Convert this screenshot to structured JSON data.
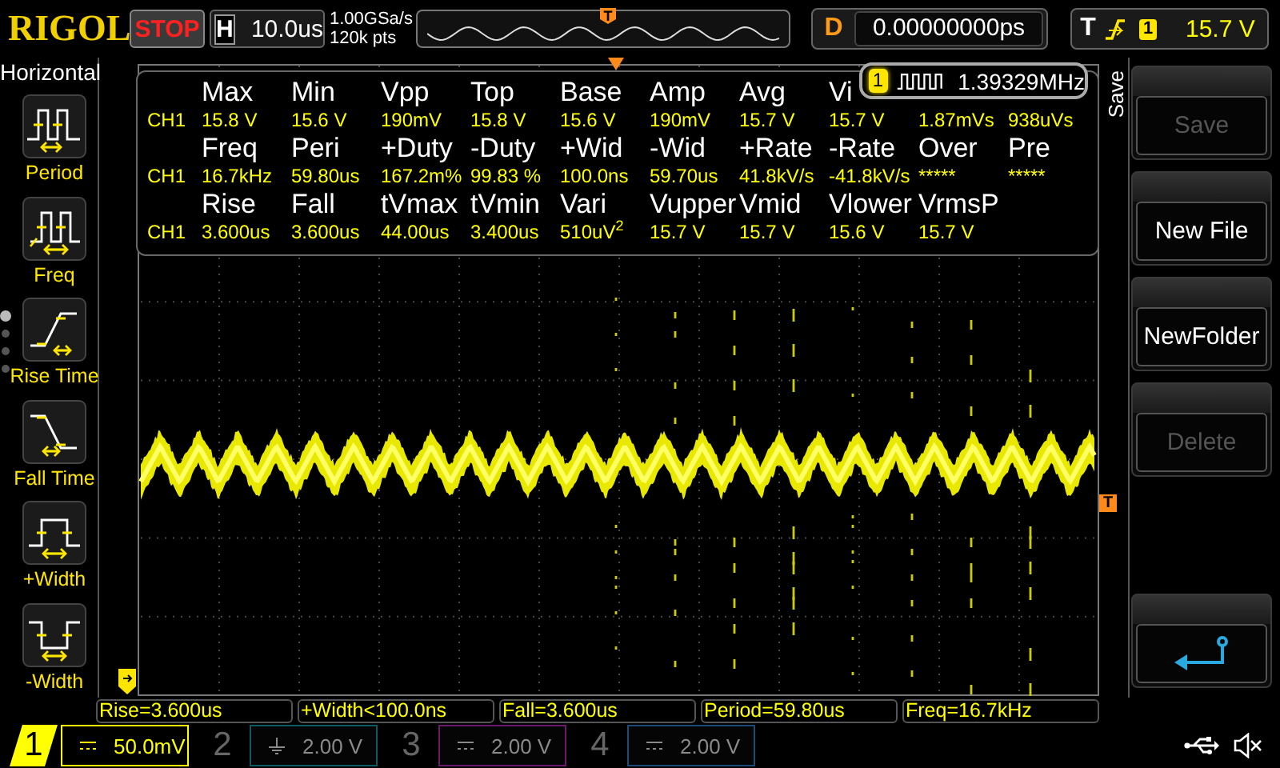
{
  "header": {
    "logo": "RIGOL",
    "run_state": {
      "label": "STOP",
      "running": false
    },
    "timebase_label": "H",
    "timebase": "10.0us",
    "sample_rate": "1.00GSa/s",
    "memory_depth": "120k pts",
    "trigger_position": "T",
    "delay_label": "D",
    "delay": "0.00000000ps",
    "trigger_label": "T",
    "trigger_edge": {
      "kind": "rising"
    },
    "trigger_source": "1",
    "trigger_level": "15.7 V"
  },
  "sidebar": {
    "title": "Horizontal",
    "page_dots": [
      {
        "selected": true
      },
      {
        "selected": false
      },
      {
        "selected": false
      },
      {
        "selected": false
      }
    ],
    "items": [
      {
        "kind": "period",
        "label": "Period"
      },
      {
        "kind": "freq",
        "label": "Freq"
      },
      {
        "kind": "rise",
        "label": "Rise Time"
      },
      {
        "kind": "fall",
        "label": "Fall Time"
      },
      {
        "kind": "pwidth",
        "label": "+Width"
      },
      {
        "kind": "nwidth",
        "label": "-Width"
      }
    ]
  },
  "measurements": {
    "rows": [
      {
        "headers": [
          "Max",
          "Min",
          "Vpp",
          "Top",
          "Base",
          "Amp",
          "Avg",
          "Vi"
        ],
        "channel": "CH1",
        "values": [
          "15.8 V",
          "15.6 V",
          "190mV",
          "15.8 V",
          "15.6 V",
          "190mV",
          "15.7 V",
          "15.7 V",
          "1.87mVs",
          "938uVs"
        ]
      },
      {
        "headers": [
          "Freq",
          "Peri",
          "+Duty",
          "-Duty",
          "+Wid",
          "-Wid",
          "+Rate",
          "-Rate",
          "Over",
          "Pre"
        ],
        "channel": "CH1",
        "values": [
          "16.7kHz",
          "59.80us",
          "167.2m%",
          "99.83 %",
          "100.0ns",
          "59.70us",
          "41.8kV/s",
          "-41.8kV/s",
          "*****",
          "*****"
        ]
      },
      {
        "headers": [
          "Rise",
          "Fall",
          "tVmax",
          "tVmin",
          "Vari",
          "Vupper",
          "Vmid",
          "Vlower",
          "VrmsP"
        ],
        "channel": "CH1",
        "values": [
          "3.600us",
          "3.600us",
          "44.00us",
          "3.400us",
          {
            "kind": "formatted",
            "text": "510uV$^{2}$"
          },
          "15.7 V",
          "15.7 V",
          "15.6 V",
          "15.7 V"
        ]
      }
    ]
  },
  "counter": {
    "channel": "1",
    "value": "1.39329MHz"
  },
  "trigger_level_marker": "T",
  "menu": {
    "title": "Save",
    "buttons": [
      {
        "kind": "text",
        "label": "Save",
        "disabled": true
      },
      {
        "kind": "text",
        "label": "New File",
        "disabled": false
      },
      {
        "kind": "text",
        "label": "NewFolder",
        "disabled": false
      },
      {
        "kind": "text",
        "label": "Delete",
        "disabled": true
      },
      {
        "kind": "back",
        "disabled": false
      }
    ]
  },
  "readouts": [
    "Rise=3.600us",
    "+Width<100.0ns",
    "Fall=3.600us",
    "Period=59.80us",
    "Freq=16.7kHz"
  ],
  "channels": [
    {
      "number": "1",
      "kind": "dc",
      "scale": "50.0mV",
      "active": true,
      "color": "#ffff00"
    },
    {
      "number": "2",
      "kind": "gnd",
      "scale": "2.00 V",
      "active": false,
      "color": "#0d5a63"
    },
    {
      "number": "3",
      "kind": "dc",
      "scale": "2.00 V",
      "active": false,
      "color": "#6b1a6b"
    },
    {
      "number": "4",
      "kind": "dc",
      "scale": "2.00 V",
      "active": false,
      "color": "#1a4a75"
    }
  ]
}
